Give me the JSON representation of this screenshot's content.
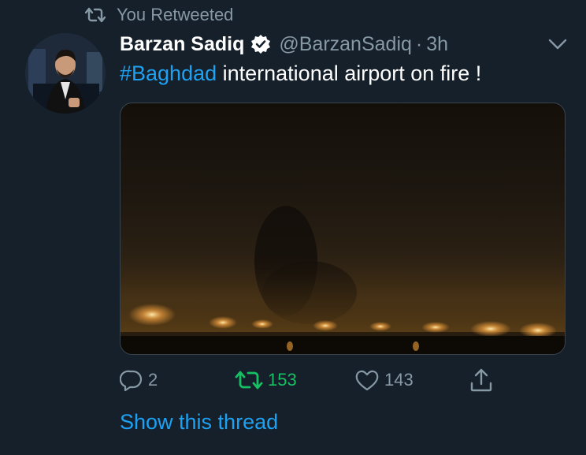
{
  "retweet_banner": {
    "text": "You Retweeted",
    "icon": "retweet-icon"
  },
  "author": {
    "display_name": "Barzan Sadiq",
    "handle": "@BarzanSadiq",
    "separator": "·",
    "time": "3h",
    "verified": true
  },
  "tweet": {
    "hashtag": "#Baghdad",
    "text": " international airport on fire !"
  },
  "actions": {
    "reply_count": "2",
    "retweet_count": "153",
    "like_count": "143"
  },
  "show_thread": "Show this thread",
  "colors": {
    "background": "#15202b",
    "accent": "#1da1f2",
    "retweeted": "#17bf63",
    "muted": "#8899a6"
  }
}
